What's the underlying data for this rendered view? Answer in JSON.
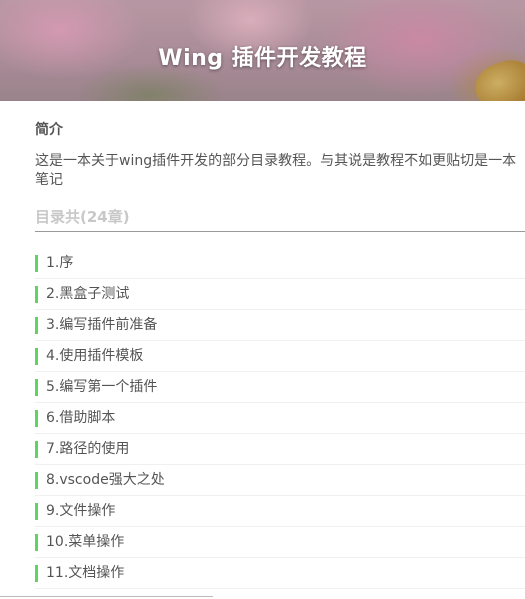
{
  "header": {
    "title": "Wing 插件开发教程"
  },
  "intro": {
    "heading": "简介",
    "text": "这是一本关于wing插件开发的部分目录教程。与其说是教程不如更贴切是一本笔记"
  },
  "toc": {
    "heading": "目录共(24章)",
    "items": [
      "1.序",
      "2.黑盒子测试",
      "3.编写插件前准备",
      "4.使用插件模板",
      "5.编写第一个插件",
      "6.借助脚本",
      "7.路径的使用",
      "8.vscode强大之处",
      "9.文件操作",
      "10.菜单操作",
      "11.文档操作"
    ]
  },
  "colors": {
    "accent_bar": "#5cd65c",
    "toc_heading": "#c8c8c8"
  }
}
